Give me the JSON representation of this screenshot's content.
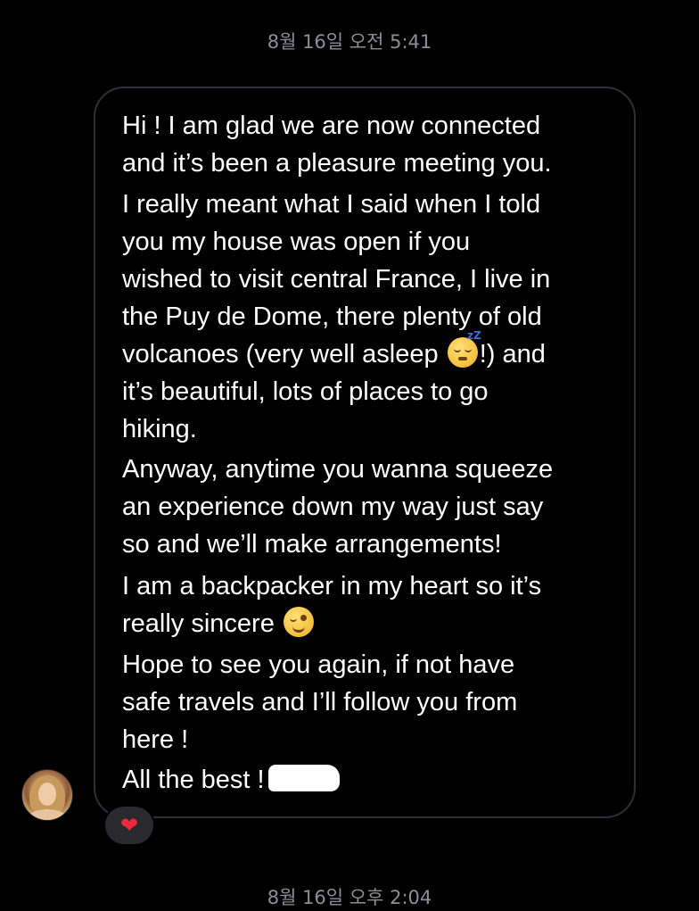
{
  "timestamps": {
    "top": "8월 16일 오전 5:41",
    "bottom": "8월 16일 오후 2:04"
  },
  "message": {
    "line_1": "Hi ! I am glad we are now connected",
    "line_2": "and it’s been a pleasure meeting you.",
    "p2": [
      "I really meant what I said when I told",
      "you my house was open if you",
      "wished to visit central France, I live in",
      "the Puy de Dome, there plenty of old"
    ],
    "p2_line5_before": "volcanoes (very well asleep",
    "p2_line5_after": "!) and",
    "p2_tail": [
      "it’s beautiful, lots of places to go",
      "hiking."
    ],
    "p3": [
      "Anyway, anytime you wanna squeeze",
      "an experience down my way just say",
      "so and we’ll make arrangements!"
    ],
    "p4_line1": "I am a backpacker in my heart so it’s",
    "p4_line2": "really sincere",
    "p5": [
      "Hope to see you again, if not have",
      "safe travels and I’ll follow you from",
      "here !"
    ],
    "p6": "All the best !",
    "sleep_emoji_zz": "zZ"
  },
  "icons": {
    "sleeping_emoji": "sleeping-face-emoji",
    "wink_emoji": "winking-face-emoji",
    "reaction": "red-heart-icon"
  },
  "reaction": {
    "glyph": "❤"
  },
  "colors": {
    "background": "#000000",
    "bubble_border": "#2f2f33",
    "timestamp": "#8e8e93",
    "text": "#ffffff",
    "reaction_bg": "#2a2a2e",
    "heart": "#ee2a3c"
  }
}
